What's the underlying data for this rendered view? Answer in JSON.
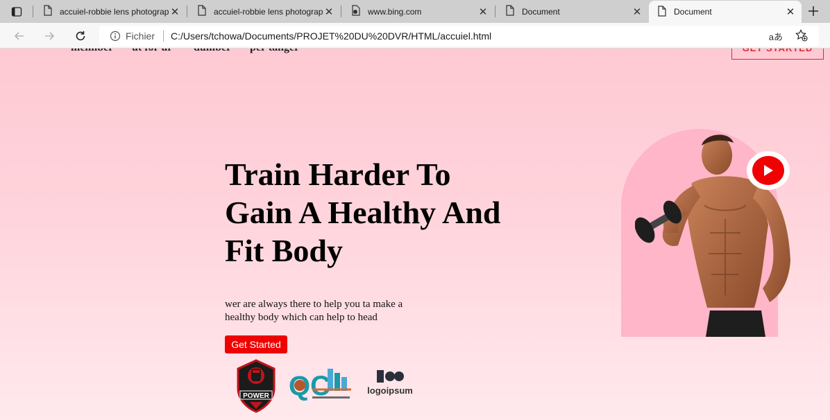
{
  "browser": {
    "tabs": [
      {
        "title": "accuiel-robbie lens photography"
      },
      {
        "title": "accuiel-robbie lens photography"
      },
      {
        "title": "www.bing.com"
      },
      {
        "title": "Document"
      },
      {
        "title": "Document"
      }
    ],
    "active_tab": 4,
    "address": {
      "scheme_label": "Fichier",
      "url": "C:/Users/tchowa/Documents/PROJET%20DU%20DVR/HTML/accuiel.html",
      "read_aloud": "aあ"
    }
  },
  "site": {
    "nav_links": [
      "meimber",
      "ut for ur",
      "dumber",
      "per tanger"
    ],
    "nav_cta": "GET STARTED",
    "hero": {
      "title": "Train Harder To Gain A Healthy And Fit Body",
      "text": "wer are always there to help you ta make a healthy body which can help to head",
      "cta": "Get Started"
    },
    "logos": {
      "power": "POWER",
      "qc": "QC",
      "ipsum": "logoipsum"
    }
  },
  "colors": {
    "accent": "#f00000",
    "hero_bg_top": "#fec9d3",
    "arch": "#ffb6c8"
  }
}
